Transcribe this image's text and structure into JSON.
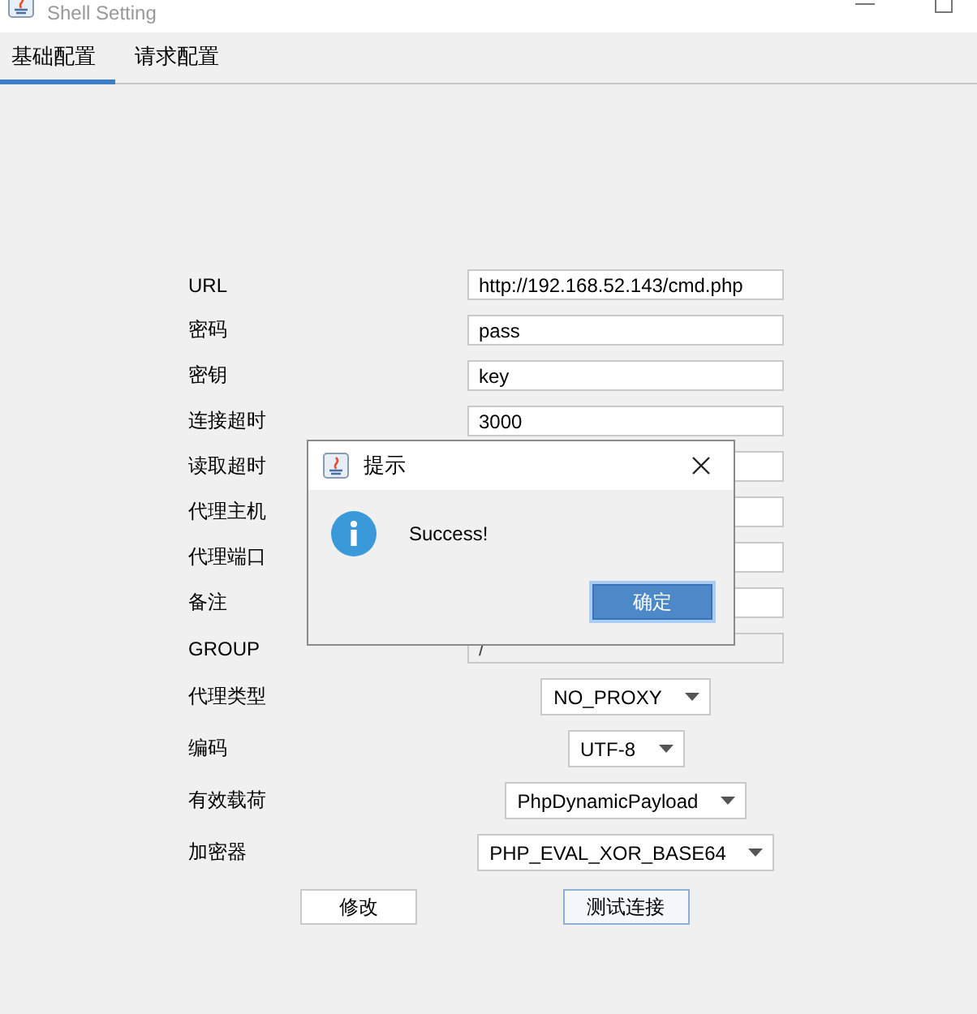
{
  "window": {
    "title": "Shell Setting"
  },
  "tabs": [
    {
      "label": "基础配置",
      "selected": true
    },
    {
      "label": "请求配置",
      "selected": false
    }
  ],
  "fields": [
    {
      "label": "URL",
      "value": "http://192.168.52.143/cmd.php",
      "disabled": false
    },
    {
      "label": "密码",
      "value": "pass",
      "disabled": false
    },
    {
      "label": "密钥",
      "value": "key",
      "disabled": false
    },
    {
      "label": "连接超时",
      "value": "3000",
      "disabled": false
    },
    {
      "label": "读取超时",
      "disabled": false
    },
    {
      "label": "代理主机",
      "disabled": false
    },
    {
      "label": "代理端口",
      "disabled": false
    },
    {
      "label": "备注",
      "disabled": false
    },
    {
      "label": "GROUP",
      "value": "/",
      "disabled": true
    }
  ],
  "selects": [
    {
      "label": "代理类型",
      "value": "NO_PROXY"
    },
    {
      "label": "编码",
      "value": "UTF-8"
    },
    {
      "label": "有效载荷",
      "value": "PhpDynamicPayload"
    },
    {
      "label": "加密器",
      "value": "PHP_EVAL_XOR_BASE64"
    }
  ],
  "buttons": [
    {
      "label": "修改",
      "focused": false
    },
    {
      "label": "测试连接",
      "focused": true
    }
  ],
  "dialog": {
    "title": "提示",
    "message": "Success!",
    "button": "确定"
  }
}
